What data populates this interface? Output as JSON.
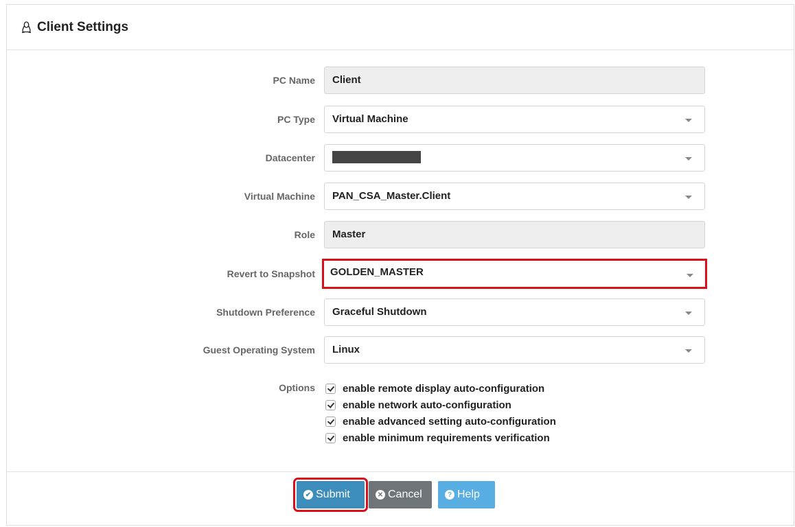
{
  "header": {
    "title": "Client Settings",
    "icon": "linux-penguin-icon"
  },
  "fields": {
    "pc_name": {
      "label": "PC Name",
      "value": "Client"
    },
    "pc_type": {
      "label": "PC Type",
      "value": "Virtual Machine"
    },
    "datacenter": {
      "label": "Datacenter",
      "value": ""
    },
    "virtual_machine": {
      "label": "Virtual Machine",
      "value": "PAN_CSA_Master.Client"
    },
    "role": {
      "label": "Role",
      "value": "Master"
    },
    "revert_snapshot": {
      "label": "Revert to Snapshot",
      "value": "GOLDEN_MASTER"
    },
    "shutdown": {
      "label": "Shutdown Preference",
      "value": "Graceful Shutdown"
    },
    "guest_os": {
      "label": "Guest Operating System",
      "value": "Linux"
    }
  },
  "options": {
    "label": "Options",
    "items": [
      {
        "label": "enable remote display auto-configuration",
        "checked": true
      },
      {
        "label": "enable network auto-configuration",
        "checked": true
      },
      {
        "label": "enable advanced setting auto-configuration",
        "checked": true
      },
      {
        "label": "enable minimum requirements verification",
        "checked": true
      }
    ]
  },
  "buttons": {
    "submit": "Submit",
    "cancel": "Cancel",
    "help": "Help"
  },
  "colors": {
    "highlight": "#d9101a",
    "submit": "#3c8dbc",
    "cancel": "#6f7479",
    "help": "#58aee3"
  }
}
